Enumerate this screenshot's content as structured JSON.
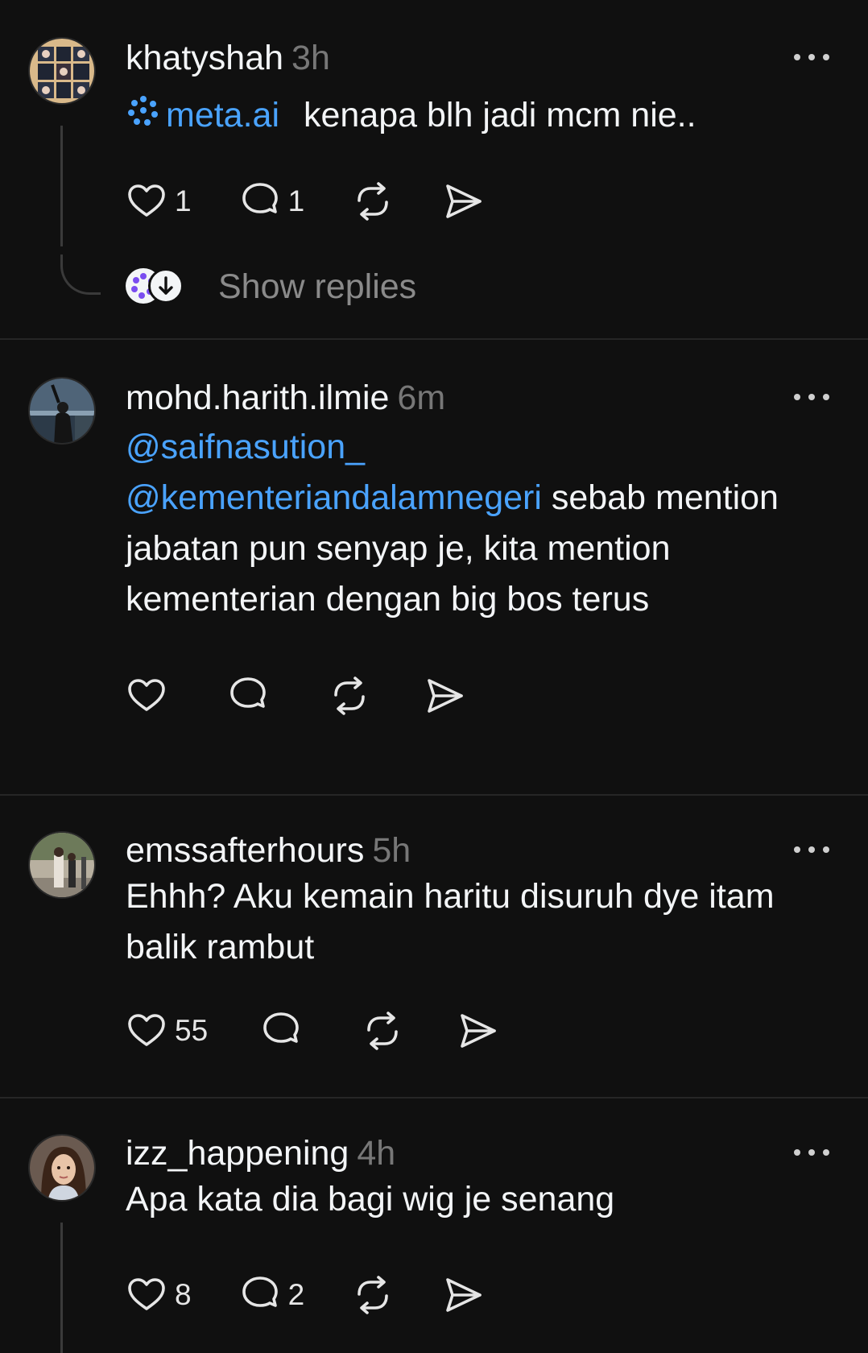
{
  "posts": [
    {
      "username": "khatyshah",
      "time": "3h",
      "mention_link": "meta.ai",
      "text": "kenapa blh jadi mcm nie..",
      "likes": "1",
      "replies": "1",
      "show_replies_label": "Show replies"
    },
    {
      "username": "mohd.harith.ilmie",
      "time": "6m",
      "mention1": "@saifnasution_",
      "mention2": "@kementeriandalamnegeri",
      "text": "sebab mention jabatan pun senyap je, kita mention kementerian dengan big bos terus",
      "likes": "",
      "replies": ""
    },
    {
      "username": "emssafterhours",
      "time": "5h",
      "text": "Ehhh? Aku kemain haritu disuruh dye itam balik rambut",
      "likes": "55",
      "replies": ""
    },
    {
      "username": "izz_happening",
      "time": "4h",
      "text": "Apa kata dia bagi wig je senang",
      "likes": "8",
      "replies": "2"
    }
  ],
  "icons": {
    "like": "heart-icon",
    "reply": "comment-bubble-icon",
    "repost": "repost-icon",
    "share": "send-icon",
    "more": "more-horizontal-icon",
    "meta_ai": "meta-ai-logo-icon",
    "show_replies": "arrow-down-circle-icon"
  },
  "colors": {
    "background": "#101010",
    "text": "#f3f5f7",
    "muted": "#777777",
    "link": "#4aa3ff",
    "divider": "#262626"
  }
}
